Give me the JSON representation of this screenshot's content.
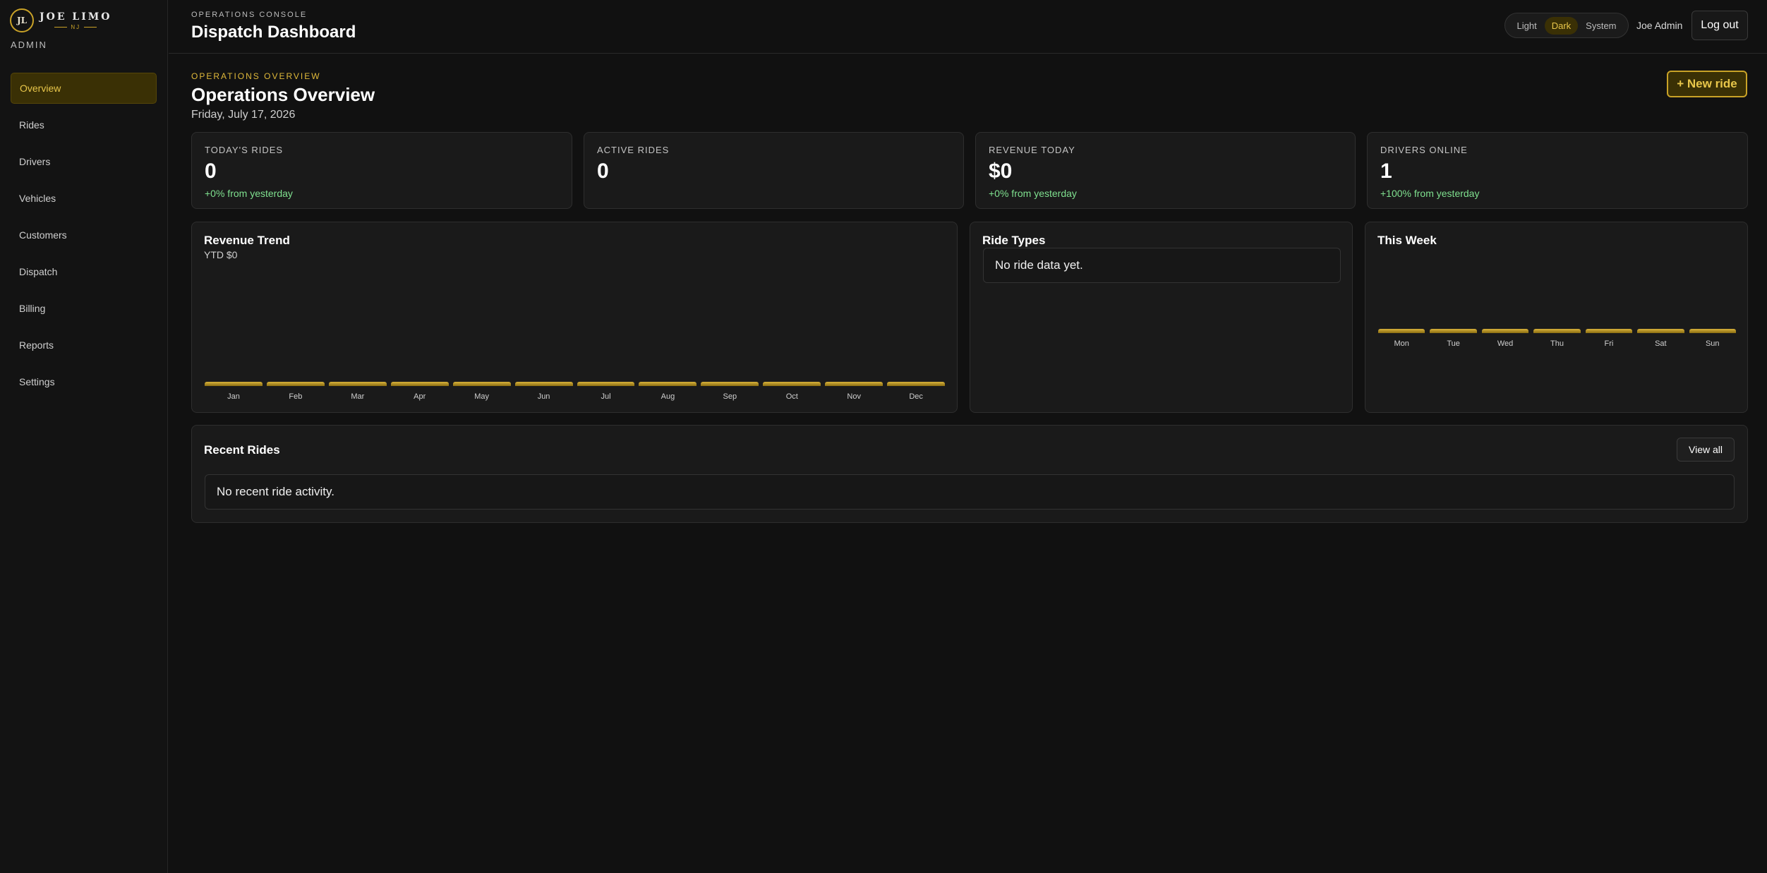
{
  "brand": {
    "mark": "JL",
    "name": "JOE LIMO",
    "sub": "NJ",
    "role": "ADMIN"
  },
  "sidebar": {
    "items": [
      {
        "label": "Overview",
        "active": true
      },
      {
        "label": "Rides"
      },
      {
        "label": "Drivers"
      },
      {
        "label": "Vehicles"
      },
      {
        "label": "Customers"
      },
      {
        "label": "Dispatch"
      },
      {
        "label": "Billing"
      },
      {
        "label": "Reports"
      },
      {
        "label": "Settings"
      }
    ]
  },
  "header": {
    "console_label": "OPERATIONS CONSOLE",
    "title": "Dispatch Dashboard",
    "theme": {
      "light": "Light",
      "dark": "Dark",
      "system": "System",
      "selected": "Dark"
    },
    "user": "Joe Admin",
    "logout": "Log out"
  },
  "page": {
    "eyebrow": "OPERATIONS OVERVIEW",
    "title": "Operations Overview",
    "date": "Friday, July 17, 2026",
    "new_ride": "+ New ride"
  },
  "stats": [
    {
      "label": "TODAY'S RIDES",
      "value": "0",
      "delta": "+0% from yesterday"
    },
    {
      "label": "ACTIVE RIDES",
      "value": "0",
      "delta": ""
    },
    {
      "label": "REVENUE TODAY",
      "value": "$0",
      "delta": "+0% from yesterday"
    },
    {
      "label": "DRIVERS ONLINE",
      "value": "1",
      "delta": "+100% from yesterday"
    }
  ],
  "revenue_trend": {
    "title": "Revenue Trend",
    "subtitle": "YTD $0"
  },
  "ride_types": {
    "title": "Ride Types",
    "empty": "No ride data yet."
  },
  "this_week": {
    "title": "This Week"
  },
  "recent_rides": {
    "title": "Recent Rides",
    "view_all": "View all",
    "empty": "No recent ride activity."
  },
  "colors": {
    "accent": "#c9a227",
    "accent_text": "#e8c64a",
    "positive": "#7fe08f",
    "background": "#111111",
    "card": "#1a1a1a"
  },
  "chart_data": [
    {
      "type": "bar",
      "title": "Revenue Trend",
      "categories": [
        "Jan",
        "Feb",
        "Mar",
        "Apr",
        "May",
        "Jun",
        "Jul",
        "Aug",
        "Sep",
        "Oct",
        "Nov",
        "Dec"
      ],
      "values": [
        0,
        0,
        0,
        0,
        0,
        0,
        0,
        0,
        0,
        0,
        0,
        0
      ]
    },
    {
      "type": "bar",
      "title": "This Week",
      "categories": [
        "Mon",
        "Tue",
        "Wed",
        "Thu",
        "Fri",
        "Sat",
        "Sun"
      ],
      "values": [
        0,
        0,
        0,
        0,
        0,
        0,
        0
      ]
    }
  ]
}
